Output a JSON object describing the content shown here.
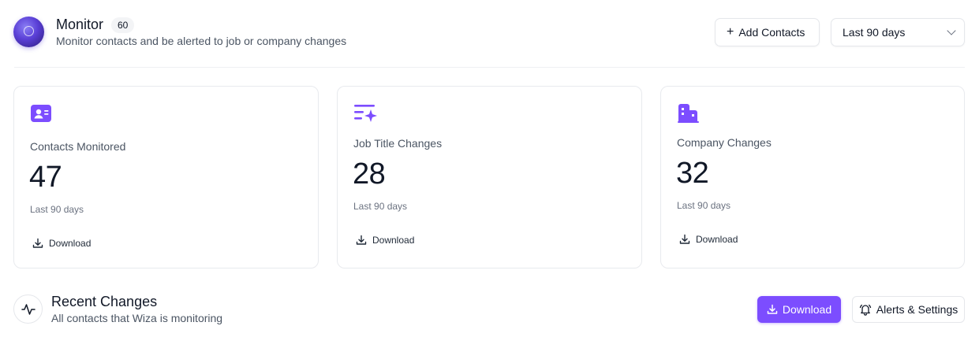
{
  "header": {
    "title": "Monitor",
    "count_badge": "60",
    "subtitle": "Monitor contacts and be alerted to job or company changes",
    "add_contacts_label": "Add Contacts",
    "range_select_value": "Last 90 days"
  },
  "cards": [
    {
      "icon": "contact-card-icon",
      "label": "Contacts Monitored",
      "value": "47",
      "period": "Last 90 days",
      "download_label": "Download"
    },
    {
      "icon": "job-title-sparkle-icon",
      "label": "Job Title Changes",
      "value": "28",
      "period": "Last 90 days",
      "download_label": "Download"
    },
    {
      "icon": "building-icon",
      "label": "Company Changes",
      "value": "32",
      "period": "Last 90 days",
      "download_label": "Download"
    }
  ],
  "recent_changes": {
    "icon": "activity-icon",
    "title": "Recent Changes",
    "subtitle": "All contacts that Wiza is monitoring",
    "download_label": "Download",
    "alerts_label": "Alerts & Settings"
  },
  "colors": {
    "accent": "#7c4dff",
    "icon_purple": "#7c4dff",
    "border": "#e8eaee",
    "muted_text": "#6b7280"
  }
}
